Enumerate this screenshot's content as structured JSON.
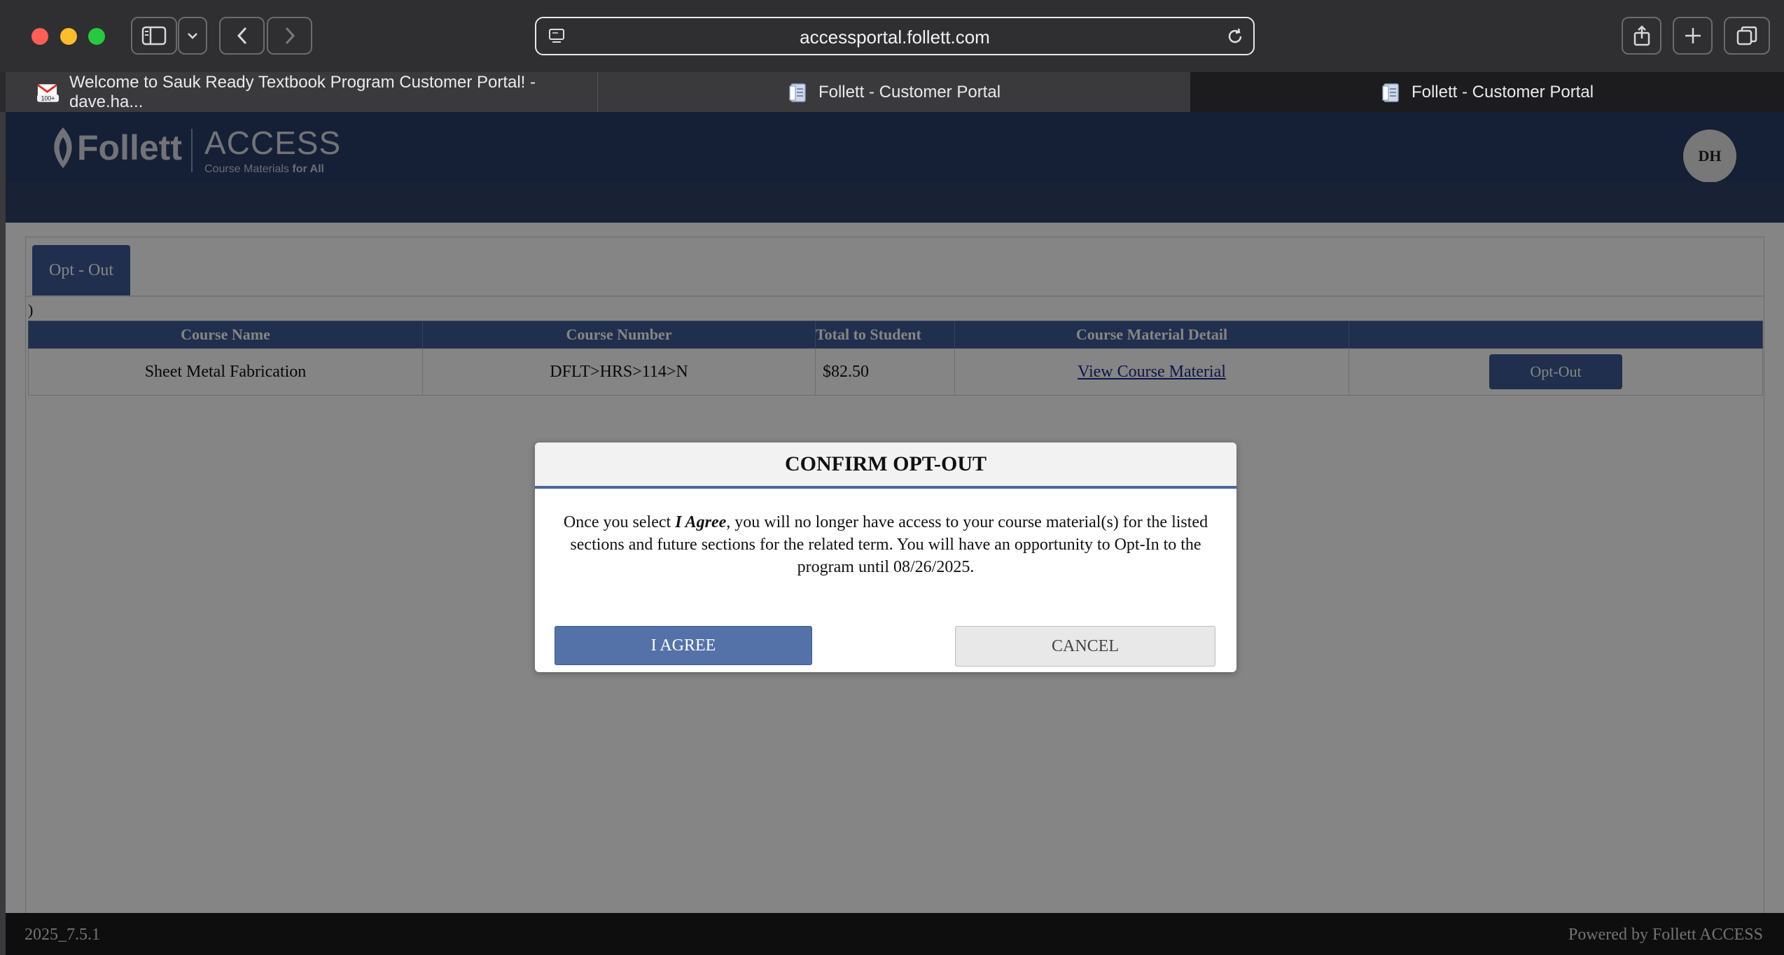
{
  "browser": {
    "url": "accessportal.follett.com",
    "tabs": [
      {
        "label": "Welcome to Sauk Ready Textbook Program Customer Portal! - dave.ha...",
        "badge": "100+"
      },
      {
        "label": "Follett - Customer Portal"
      },
      {
        "label": "Follett - Customer Portal"
      }
    ]
  },
  "header": {
    "logo_brand": "Follett",
    "logo_product": "ACCESS",
    "logo_tagline_a": "Course Materials ",
    "logo_tagline_b": "for All",
    "avatar_initials": "DH"
  },
  "tab_label": "Opt - Out",
  "stray_char": ")",
  "table": {
    "columns": [
      "Course Name",
      "Course Number",
      "Total to Student",
      "Course Material Detail",
      ""
    ],
    "rows": [
      {
        "course_name": "Sheet Metal Fabrication",
        "course_number": "DFLT>HRS>114>N",
        "total": "$82.50",
        "detail_link": "View Course Material",
        "action": "Opt-Out"
      }
    ]
  },
  "modal": {
    "title": "CONFIRM OPT-OUT",
    "body_pre": "Once you select ",
    "body_em": "I Agree",
    "body_post": ", you will no longer have access to your course material(s) for the listed sections and future sections for the related term. You will have an opportunity to Opt-In to the program until 08/26/2025.",
    "agree_label": "I AGREE",
    "cancel_label": "CANCEL"
  },
  "footer": {
    "version": "2025_7.5.1",
    "powered_by": "Powered by Follett ACCESS"
  },
  "colors": {
    "header_navy": "#2a3d66",
    "accent_blue": "#3f5b95",
    "agree_blue": "#5472a8"
  }
}
